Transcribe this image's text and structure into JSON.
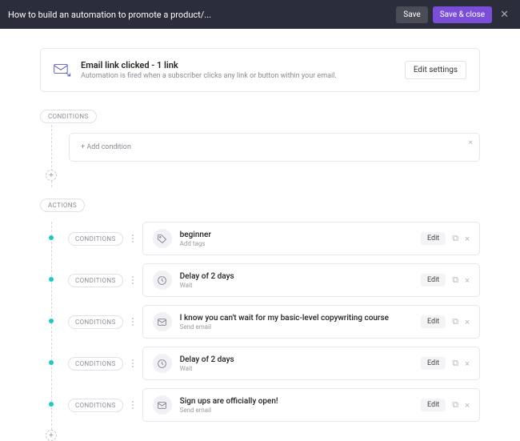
{
  "header": {
    "title": "How to build an automation to promote a product/...",
    "save": "Save",
    "save_close": "Save & close"
  },
  "trigger": {
    "title": "Email link clicked - 1 link",
    "desc": "Automation is fired when a subscriber clicks any link or button within your email.",
    "edit": "Edit settings"
  },
  "conditions": {
    "label": "CONDITIONS",
    "add": "+ Add condition"
  },
  "actions": {
    "label": "ACTIONS",
    "cond_pill": "Conditions",
    "edit": "Edit",
    "items": [
      {
        "title": "beginner",
        "sub": "Add tags",
        "icon": "tag"
      },
      {
        "title": "Delay of 2 days",
        "sub": "Wait",
        "icon": "clock"
      },
      {
        "title": "I know you can't wait for my basic-level copywriting course",
        "sub": "Send email",
        "icon": "mail"
      },
      {
        "title": "Delay of 2 days",
        "sub": "Wait",
        "icon": "clock"
      },
      {
        "title": "Sign ups are officially open!",
        "sub": "Send email",
        "icon": "mail"
      }
    ]
  }
}
